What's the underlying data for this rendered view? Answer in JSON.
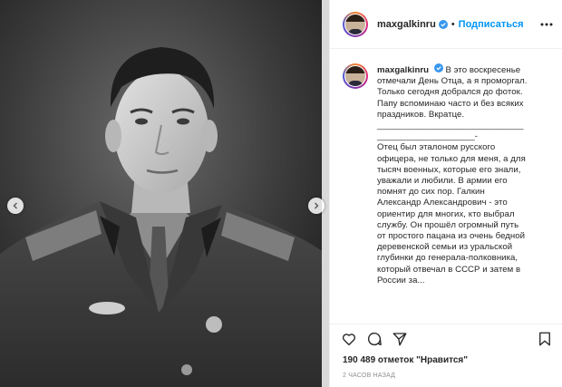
{
  "header": {
    "username": "maxgalkinru",
    "separator": "•",
    "follow_label": "Подписаться"
  },
  "caption": {
    "username": "maxgalkinru",
    "lines": [
      "В это воскресенье",
      "отмечали День Отца, а я проморгал.",
      "Только сегодня добрался до фоток.",
      "Папу вспоминаю часто и без всяких",
      "праздников. Вкратце.",
      "______________________________",
      "____________________-",
      "Отец был эталоном русского",
      "офицера, не только для меня, а для",
      "тысяч военных, которые его знали,",
      "уважали и любили. В армии его",
      "помнят до сих пор. Галкин",
      "Александр Александрович - это",
      "ориентир для многих, кто выбрал",
      "службу. Он прошёл огромный путь",
      "от простого пацана из очень бедной",
      "деревенской семьи из уральской",
      "глубинки до генерала-полковника,",
      "который отвечал в СССР и затем в",
      "России за..."
    ]
  },
  "stats": {
    "likes_text": "190 489 отметок \"Нравится\"",
    "time_text": "2 ЧАСОВ НАЗАД"
  },
  "icons": {
    "verified": "verified-badge-icon",
    "more": "more-options-icon",
    "like": "heart-icon",
    "comment": "comment-icon",
    "share": "share-icon",
    "save": "bookmark-icon",
    "prev": "chevron-left-icon",
    "next": "chevron-right-icon"
  },
  "colors": {
    "accent": "#0095f6",
    "text": "#262626",
    "muted": "#8e8e8e",
    "divider": "#efefef"
  }
}
